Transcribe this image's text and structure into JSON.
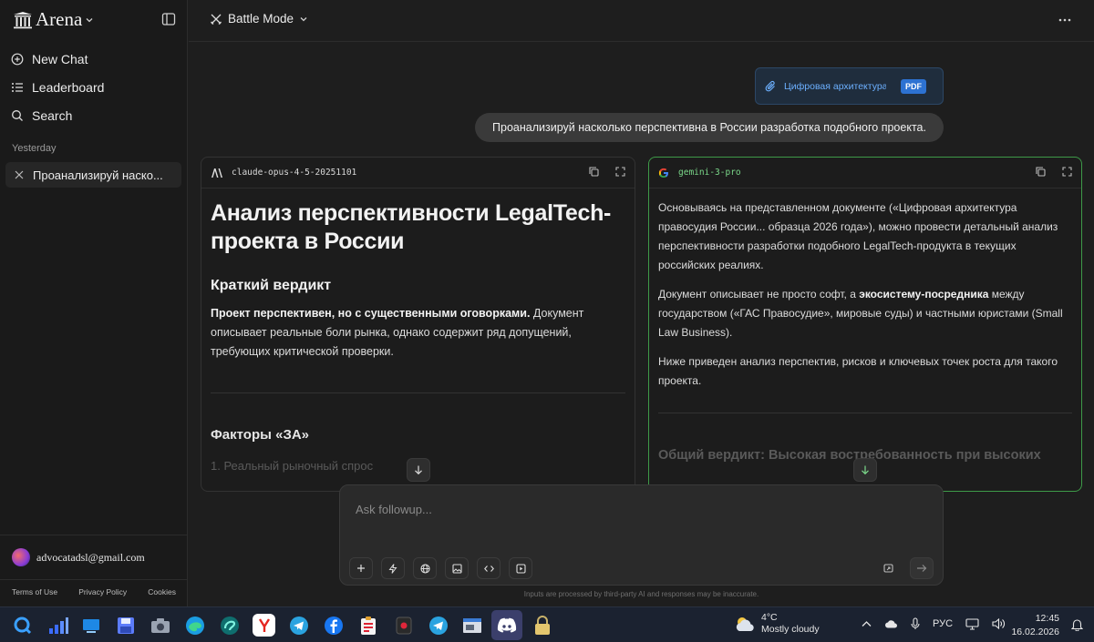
{
  "sidebar": {
    "brand": "Arena",
    "nav": [
      {
        "label": "New Chat",
        "icon": "plus-circle-icon"
      },
      {
        "label": "Leaderboard",
        "icon": "list-icon"
      },
      {
        "label": "Search",
        "icon": "search-icon"
      }
    ],
    "section_label": "Yesterday",
    "history": [
      {
        "label": "Проанализируй наско..."
      }
    ],
    "user_email": "advocatadsl@gmail.com",
    "footer": {
      "terms": "Terms of Use",
      "privacy": "Privacy Policy",
      "cookies": "Cookies"
    }
  },
  "topbar": {
    "mode": "Battle Mode"
  },
  "attachment": {
    "name": "Цифровая архитектура ...",
    "type": "PDF"
  },
  "user_message": "Проанализируй насколько перспективна в России разработка подобного проекта.",
  "left_panel": {
    "model": "claude-opus-4-5-20251101",
    "title": "Анализ перспективности LegalTech-проекта в России",
    "verdict_heading": "Краткий вердикт",
    "verdict_bold": "Проект перспективен, но с существенными оговорками.",
    "verdict_text": " Документ описывает реальные боли рынка, однако содержит ряд допущений, требующих критической проверки.",
    "factors_heading": "Факторы «ЗА»",
    "factor_1": "1. Реальный рыночный спрос"
  },
  "right_panel": {
    "model": "gemini-3-pro",
    "p1": "Основываясь на представленном документе («Цифровая архитектура правосудия России... образца 2026 года»), можно провести детальный анализ перспективности разработки подобного LegalTech-продукта в текущих российских реалиях.",
    "p2_before": "Документ описывает не просто софт, а ",
    "p2_bold": "экосистему-посредника",
    "p2_after": " между государством («ГАС Правосудие», мировые суды) и частными юристами (Small Law Business).",
    "p3": "Ниже приведен анализ перспектив, рисков и ключевых точек роста для такого проекта.",
    "faded_heading": "Общий вердикт: Высокая востребованность при высоких"
  },
  "composer": {
    "placeholder": "Ask followup...",
    "disclaimer": "Inputs are processed by third-party AI and responses may be inaccurate."
  },
  "taskbar": {
    "weather_temp": "4°C",
    "weather_desc": "Mostly cloudy",
    "lang": "РУС",
    "time": "12:45",
    "date": "16.02.2026"
  },
  "colors": {
    "background": "#1e1e1e",
    "accent_green": "#3e9a48",
    "link_blue": "#6cb0ff",
    "pdf_badge": "#2d72d2"
  }
}
